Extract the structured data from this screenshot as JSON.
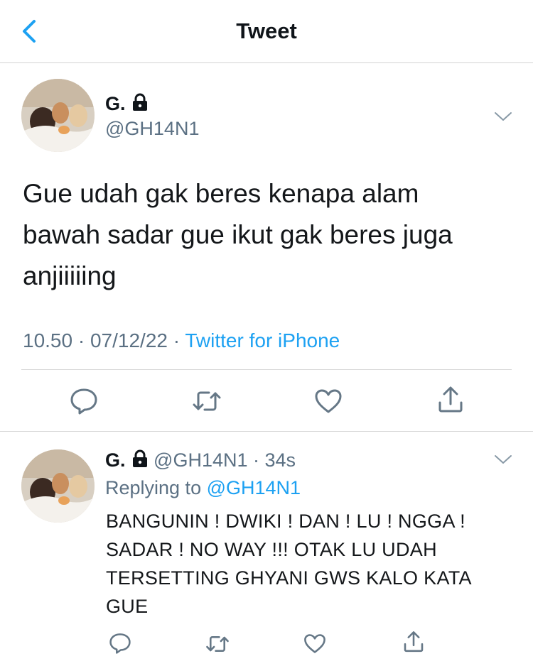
{
  "header": {
    "title": "Tweet"
  },
  "main_tweet": {
    "display_name": "G.",
    "handle": "@GH14N1",
    "text_lines": [
      "Gue udah gak beres kenapa alam",
      "bawah sadar gue ikut gak beres juga",
      "anjiiiiing"
    ],
    "time": "10.50",
    "date": "07/12/22",
    "source": "Twitter for iPhone",
    "separator": "·"
  },
  "reply": {
    "display_name": "G.",
    "handle": "@GH14N1",
    "age": "34s",
    "replying_prefix": "Replying to",
    "replying_handle": "@GH14N1",
    "text_lines": [
      "BANGUNIN ! DWIKI ! DAN ! LU ! NGGA !",
      "SADAR ! NO WAY !!! OTAK LU UDAH",
      "TERSETTING GHYANI GWS KALO KATA",
      "GUE"
    ]
  },
  "colors": {
    "accent": "#1da1f2",
    "muted": "#5b7083",
    "icon": "#657786"
  },
  "icons": [
    "back-icon",
    "lock-icon",
    "chevron-down-icon",
    "reply-icon",
    "retweet-icon",
    "like-icon",
    "share-icon"
  ]
}
